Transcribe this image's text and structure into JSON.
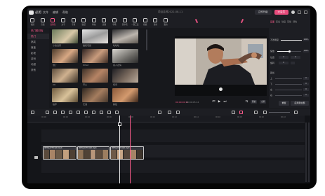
{
  "app": {
    "logo_text": "必剪",
    "menu": [
      "文件",
      "编辑",
      "帮助"
    ],
    "project_title": "项目名称2022-08-11",
    "buttons": {
      "upgrade": "立即升级",
      "vip": "大会员"
    }
  },
  "media_toolbar": [
    {
      "label": "视频",
      "icon": "video-icon"
    },
    {
      "label": "音频",
      "icon": "music-icon"
    },
    {
      "label": "表情包",
      "icon": "sticker-icon",
      "active": true
    },
    {
      "label": "文字",
      "icon": "text-icon"
    },
    {
      "label": "字幕",
      "icon": "subtitle-icon"
    },
    {
      "label": "贴纸",
      "icon": "paste-icon"
    },
    {
      "label": "特效",
      "icon": "effect-icon"
    },
    {
      "label": "滤镜",
      "icon": "filter-icon"
    },
    {
      "label": "转场",
      "icon": "transition-icon"
    },
    {
      "label": "画中画",
      "icon": "pip-icon"
    },
    {
      "label": "一键三连",
      "icon": "like-icon"
    },
    {
      "label": "模板",
      "icon": "template-icon"
    },
    {
      "label": "素材",
      "icon": "asset-icon"
    },
    {
      "label": "我的",
      "icon": "user-icon"
    }
  ],
  "categories": {
    "head": "热门素材库",
    "items": [
      "热门",
      "搞笑",
      "鬼畜",
      "影视",
      "游戏",
      "动漫",
      "其他"
    ],
    "selected": 0
  },
  "media": [
    {
      "label": "小鬼当家"
    },
    {
      "label": "猫和老鼠"
    },
    {
      "label": "哈哈哈"
    },
    {
      "label": "懵了"
    },
    {
      "label": "What"
    },
    {
      "label": "真人表情"
    },
    {
      "label": "OK"
    },
    {
      "label": "开心"
    },
    {
      "label": "惊讶"
    },
    {
      "label": "拍手"
    },
    {
      "label": "无语"
    },
    {
      "label": "尴尬"
    }
  ],
  "player": {
    "current_time": "00:00:00:11",
    "total_time": "00:00:05:14",
    "ratio_label": "原始",
    "fullscreen_label": "全屏"
  },
  "props": {
    "tabs": [
      "画面",
      "变速",
      "动画",
      "蒙版",
      "调色"
    ],
    "active_tab": 0,
    "opacity_label": "不透明度",
    "opacity_value": "100%",
    "scale_label": "缩放",
    "scale_value": "100%",
    "position_label": "位置",
    "rotate_label": "旋转",
    "crop_label": "裁剪",
    "crop_top": "上",
    "crop_bottom": "下",
    "crop_left": "左",
    "crop_right": "右",
    "zero": "0",
    "reset": "重置",
    "apply_all": "应用到全部"
  },
  "timeline": {
    "ticks": [
      "00:00",
      "00:02",
      "00:04",
      "00:06",
      "00:08",
      "00:10",
      "00:12",
      "00:14",
      "00:16",
      "00:18",
      "00:20",
      "00:22",
      "00:24"
    ],
    "clips": [
      "IWWaAVTICleR.mp4",
      "IWWaAVTICleR.mp4",
      "IWWaAVTICleR.mp4"
    ],
    "meter_labels": [
      "0",
      "-6",
      "-12",
      "-18",
      "-24",
      "-30",
      "-36",
      "-42",
      "-48"
    ]
  }
}
